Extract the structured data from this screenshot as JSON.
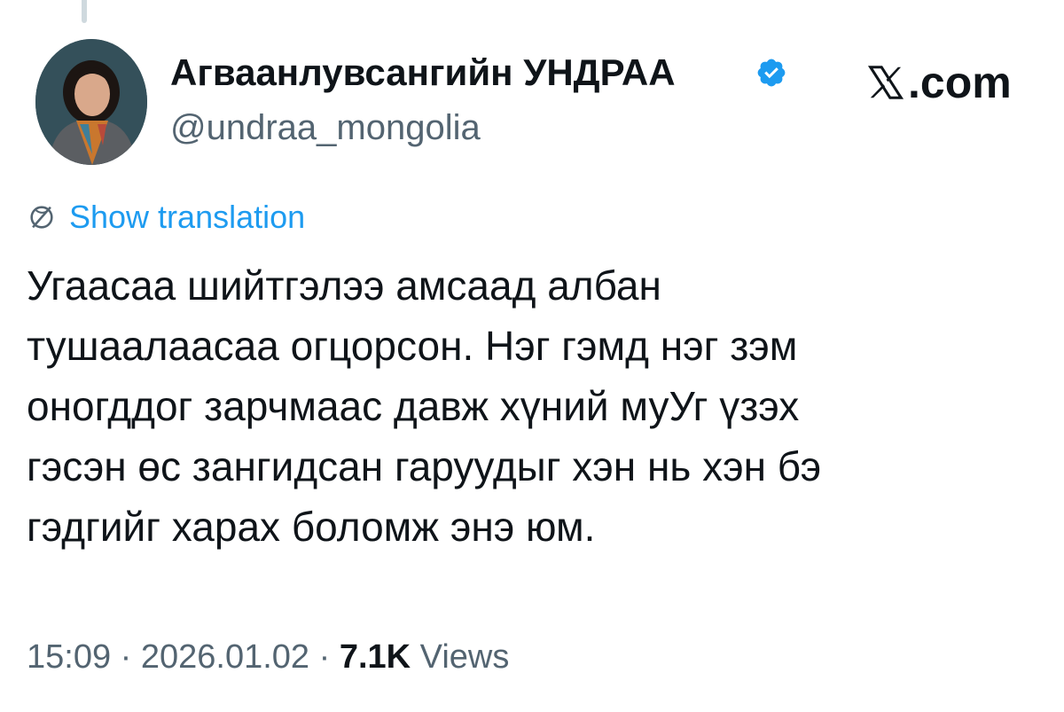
{
  "author": {
    "name": "Агваанлувсангийн УНДРАА",
    "handle": "@undraa_mongolia",
    "verified": true,
    "verified_color": "#1d9bf0"
  },
  "brand": {
    "logo_text": ".com",
    "logo_icon": "x-logo-icon"
  },
  "translation": {
    "label": "Show translation",
    "icon": "globe-icon",
    "color": "#1d9bf0"
  },
  "tweet": {
    "lines": [
      "Угаасаа шийтгэлээ амсаад албан",
      "тушаалаасаа огцорсон. Нэг гэмд нэг зэм",
      "оногддог зарчмаас давж хүний муУг үзэх",
      "гэсэн өс зангидсан гаруудыг хэн нь хэн бэ",
      "гэдгийг харах боломж энэ юм."
    ]
  },
  "meta": {
    "time": "15:09",
    "separator": " · ",
    "date": "2026.01.02",
    "views_count": "7.1K",
    "views_label": " Views"
  }
}
